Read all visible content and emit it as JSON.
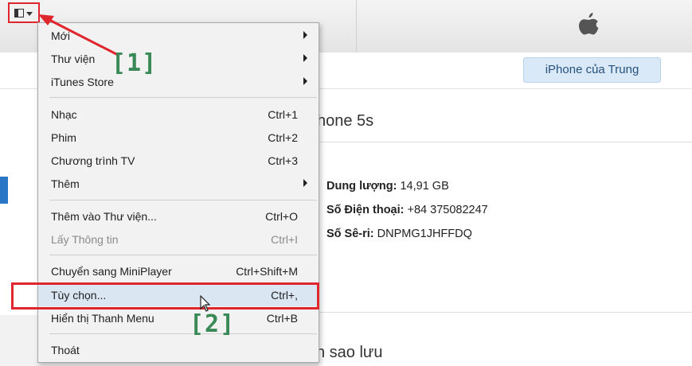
{
  "window": {
    "device_button": "iPhone của Trung",
    "device_name": "hone 5s",
    "backup_heading": "n sao lưu"
  },
  "device_info": {
    "capacity_label": "Dung lượng:",
    "capacity_value": "14,91 GB",
    "phone_label": "Số Điện thoại:",
    "phone_value": "+84 375082247",
    "serial_label": "Số Sê-ri:",
    "serial_value": "DNPMG1JHFFDQ"
  },
  "menu": {
    "items": [
      {
        "label": "Mới",
        "shortcut": "",
        "submenu": true
      },
      {
        "label": "Thư viện",
        "shortcut": "",
        "submenu": true
      },
      {
        "label": "iTunes Store",
        "shortcut": "",
        "submenu": true
      },
      {
        "label": "Nhạc",
        "shortcut": "Ctrl+1",
        "submenu": false
      },
      {
        "label": "Phim",
        "shortcut": "Ctrl+2",
        "submenu": false
      },
      {
        "label": "Chương trình TV",
        "shortcut": "Ctrl+3",
        "submenu": false
      },
      {
        "label": "Thêm",
        "shortcut": "",
        "submenu": true
      },
      {
        "label": "Thêm vào Thư viện...",
        "shortcut": "Ctrl+O",
        "submenu": false
      },
      {
        "label": "Lấy Thông tin",
        "shortcut": "Ctrl+I",
        "submenu": false,
        "disabled": true
      },
      {
        "label": "Chuyển sang MiniPlayer",
        "shortcut": "Ctrl+Shift+M",
        "submenu": false
      },
      {
        "label": "Tùy chọn...",
        "shortcut": "Ctrl+,",
        "submenu": false
      },
      {
        "label": "Hiển thị Thanh Menu",
        "shortcut": "Ctrl+B",
        "submenu": false
      },
      {
        "label": "Thoát",
        "shortcut": "",
        "submenu": false
      }
    ]
  },
  "annotations": {
    "step1": "[1]",
    "step2": "[2]"
  },
  "colors": {
    "highlight_red": "#e0262d",
    "annotation_green": "#3a8a57",
    "accent_blue": "#2a76c6"
  },
  "icons": {
    "menu_button": "sidebar-menu-icon",
    "apple": "apple-logo-icon",
    "cursor": "mouse-pointer-icon"
  }
}
